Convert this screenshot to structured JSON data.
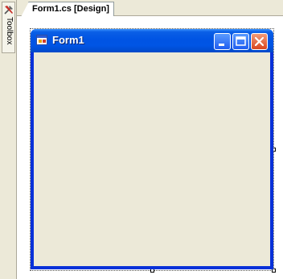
{
  "toolbox": {
    "label": "Toolbox",
    "icon": "toolbox-icon"
  },
  "document_tab": {
    "label": "Form1.cs [Design]"
  },
  "form": {
    "title": "Form1",
    "icon": "form-icon",
    "buttons": [
      "minimize-icon",
      "maximize-icon",
      "close-icon"
    ],
    "client_color": "#ece9d8",
    "titlebar_color": "#0054e3"
  }
}
